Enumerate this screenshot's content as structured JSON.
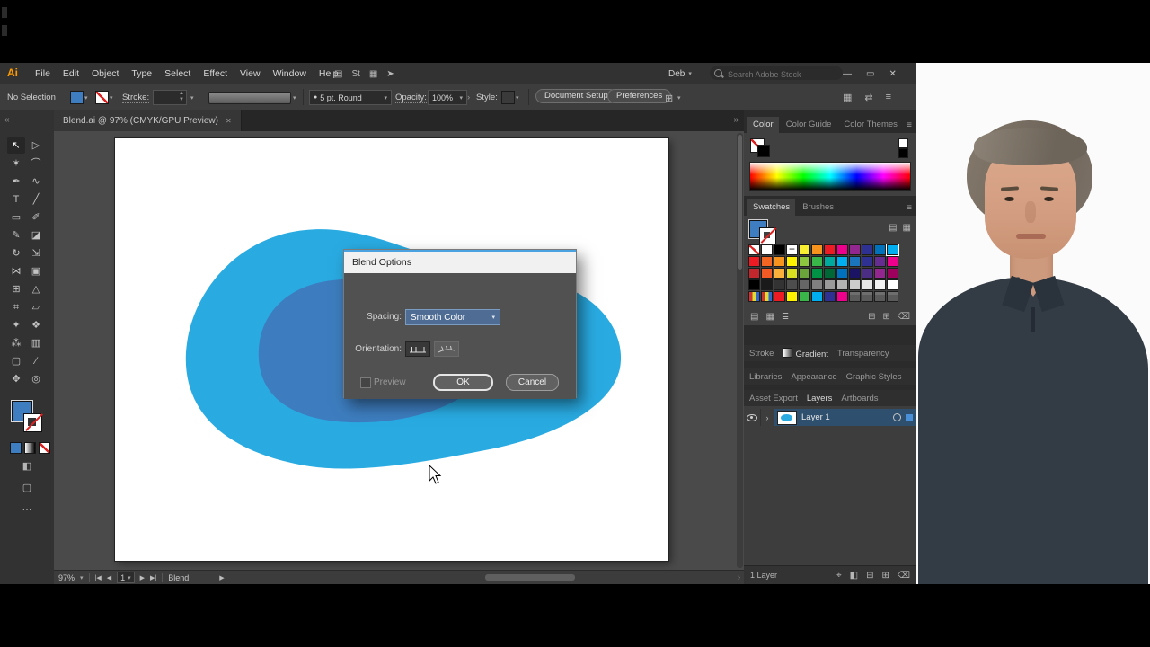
{
  "colors": {
    "blob_outer": "#29ABE2",
    "blob_inner": "#3D7DBF",
    "fill_blue": "#3E7EC0",
    "selected_layer": "#2F4F6E",
    "dialog_title_bg": "#F1F1F1",
    "accent_focus": "#4AA3E0",
    "person_shirt": "#333B45",
    "person_skin": "#D8A489",
    "person_hair": "#84796C"
  },
  "ui": {
    "caret": "▾",
    "collapse_left": "«",
    "collapse_right": "»",
    "bullet": "●",
    "chevron_right": "›",
    "menu_icon": "≡"
  },
  "menu_bar": {
    "logo": "Ai",
    "items": [
      "File",
      "Edit",
      "Object",
      "Type",
      "Select",
      "Effect",
      "View",
      "Window",
      "Help"
    ],
    "profile_label": "Deb",
    "search_placeholder": "Search Adobe Stock",
    "app_icons": [
      {
        "name": "document-arrange-icon",
        "glyph": "▤"
      },
      {
        "name": "touch-workspace-button",
        "glyph": "St"
      },
      {
        "name": "layout-options-icon",
        "glyph": "▦"
      },
      {
        "name": "gpu-performance-icon",
        "glyph": "➤"
      }
    ],
    "window_controls": [
      {
        "name": "minimize-button",
        "glyph": "—"
      },
      {
        "name": "restore-button",
        "glyph": "▭"
      },
      {
        "name": "close-button",
        "glyph": "✕"
      }
    ]
  },
  "control_bar": {
    "no_selection": "No Selection",
    "stroke_label": "Stroke:",
    "brush_value": "5 pt. Round",
    "opacity_label": "Opacity:",
    "opacity_value": "100%",
    "style_label": "Style:",
    "document_setup_label": "Document Setup",
    "preferences_label": "Preferences",
    "right_icons": [
      {
        "name": "panels-grid-icon",
        "glyph": "▦"
      },
      {
        "name": "arrange-panels-icon",
        "glyph": "⇄"
      },
      {
        "name": "panel-menu-icon",
        "glyph": "≡"
      }
    ]
  },
  "document_tab": {
    "title": "Blend.ai @ 97% (CMYK/GPU Preview)",
    "close_glyph": "✕"
  },
  "toolbar": {
    "tools": [
      {
        "name": "selection-tool",
        "glyph": "↖"
      },
      {
        "name": "direct-selection-tool",
        "glyph": "▷"
      },
      {
        "name": "magic-wand-tool",
        "glyph": "✶"
      },
      {
        "name": "lasso-tool",
        "glyph": "⌒"
      },
      {
        "name": "pen-tool",
        "glyph": "✒"
      },
      {
        "name": "curvature-tool",
        "glyph": "∿"
      },
      {
        "name": "type-tool",
        "glyph": "T"
      },
      {
        "name": "line-segment-tool",
        "glyph": "╱"
      },
      {
        "name": "rectangle-tool",
        "glyph": "▭"
      },
      {
        "name": "paintbrush-tool",
        "glyph": "✐"
      },
      {
        "name": "shaper-tool",
        "glyph": "✎"
      },
      {
        "name": "eraser-tool",
        "glyph": "◪"
      },
      {
        "name": "rotate-tool",
        "glyph": "↻"
      },
      {
        "name": "scale-tool",
        "glyph": "⇲"
      },
      {
        "name": "width-tool",
        "glyph": "⋈"
      },
      {
        "name": "free-transform-tool",
        "glyph": "▣"
      },
      {
        "name": "shape-builder-tool",
        "glyph": "⊞"
      },
      {
        "name": "perspective-grid-tool",
        "glyph": "△"
      },
      {
        "name": "mesh-tool",
        "glyph": "⌗"
      },
      {
        "name": "gradient-tool",
        "glyph": "▱"
      },
      {
        "name": "eyedropper-tool",
        "glyph": "✦"
      },
      {
        "name": "blend-tool",
        "glyph": "❖"
      },
      {
        "name": "symbol-sprayer-tool",
        "glyph": "⁂"
      },
      {
        "name": "column-graph-tool",
        "glyph": "▥"
      },
      {
        "name": "artboard-tool",
        "glyph": "▢"
      },
      {
        "name": "slice-tool",
        "glyph": "∕"
      },
      {
        "name": "hand-tool",
        "glyph": "✥"
      },
      {
        "name": "zoom-tool",
        "glyph": "◎"
      }
    ]
  },
  "dialog": {
    "title": "Blend Options",
    "spacing_label": "Spacing:",
    "spacing_value": "Smooth Color",
    "orientation_label": "Orientation:",
    "preview_label": "Preview",
    "ok_label": "OK",
    "cancel_label": "Cancel"
  },
  "panels": {
    "color_tabs": [
      "Color",
      "Color Guide",
      "Color Themes"
    ],
    "swatch_tabs": [
      "Swatches",
      "Brushes"
    ],
    "collapsed_tabs_1": [
      "Stroke",
      "Gradient",
      "Transparency"
    ],
    "collapsed_tabs_2": [
      "Libraries",
      "Appearance",
      "Graphic Styles"
    ],
    "dock_tabs": [
      "Asset Export",
      "Layers",
      "Artboards"
    ],
    "swatches": {
      "grid": [
        [
          "none",
          "#FFFFFF",
          "#000000",
          "reg",
          "#F8ED31",
          "#F7941D",
          "#ED1C24",
          "#EC008C",
          "#92278F",
          "#2E3192",
          "#0072BC",
          "#00AEEF"
        ],
        [
          "#ED1C24",
          "#F26522",
          "#F7941D",
          "#FFF200",
          "#8DC63F",
          "#39B54A",
          "#00A99D",
          "#00AEEF",
          "#1B75BC",
          "#2E3192",
          "#662D91",
          "#EC008C"
        ],
        [
          "#C1272D",
          "#F15A24",
          "#FBB03B",
          "#D9E021",
          "#6BA43A",
          "#009245",
          "#006837",
          "#0071BC",
          "#1B1464",
          "#4B2E83",
          "#93278F",
          "#9E005D"
        ],
        [
          "#000000",
          "#1A1A1A",
          "#333333",
          "#4D4D4D",
          "#666666",
          "#808080",
          "#999999",
          "#B3B3B3",
          "#CCCCCC",
          "#E6E6E6",
          "#F2F2F2",
          "#FFFFFF"
        ],
        [
          "group",
          "group",
          "#ED1C24",
          "#FFF200",
          "#39B54A",
          "#00AEEF",
          "#2E3192",
          "#EC008C",
          "folder",
          "folder",
          "folder",
          "folder"
        ]
      ],
      "selected_cell": [
        0,
        11
      ],
      "view_icons": [
        {
          "name": "swatch-list-view-icon",
          "glyph": "▤"
        },
        {
          "name": "swatch-grid-view-icon",
          "glyph": "▦"
        }
      ],
      "footer_icons": [
        {
          "name": "swatch-libraries-icon",
          "glyph": "▤"
        },
        {
          "name": "swatch-kinds-icon",
          "glyph": "▦"
        },
        {
          "name": "swatch-options-icon",
          "glyph": "≣"
        },
        {
          "name": "new-color-group-icon",
          "glyph": "⊟"
        },
        {
          "name": "new-swatch-icon",
          "glyph": "⊞"
        },
        {
          "name": "delete-swatch-icon",
          "glyph": "⌫"
        }
      ]
    }
  },
  "layers": {
    "layer_name": "Layer 1",
    "count_label": "1 Layer",
    "footer_icons": [
      {
        "name": "locate-object-icon",
        "glyph": "⌖"
      },
      {
        "name": "make-mask-icon",
        "glyph": "◧"
      },
      {
        "name": "new-sublayer-icon",
        "glyph": "⊟"
      },
      {
        "name": "new-layer-icon",
        "glyph": "⊞"
      },
      {
        "name": "delete-layer-icon",
        "glyph": "⌫"
      }
    ]
  },
  "status_bar": {
    "zoom": "97%",
    "nav_first": "|◀",
    "nav_prev": "◀",
    "artboard_number": "1",
    "nav_next": "▶",
    "nav_last": "▶|",
    "artboard_name": "Blend",
    "play": "▶"
  }
}
